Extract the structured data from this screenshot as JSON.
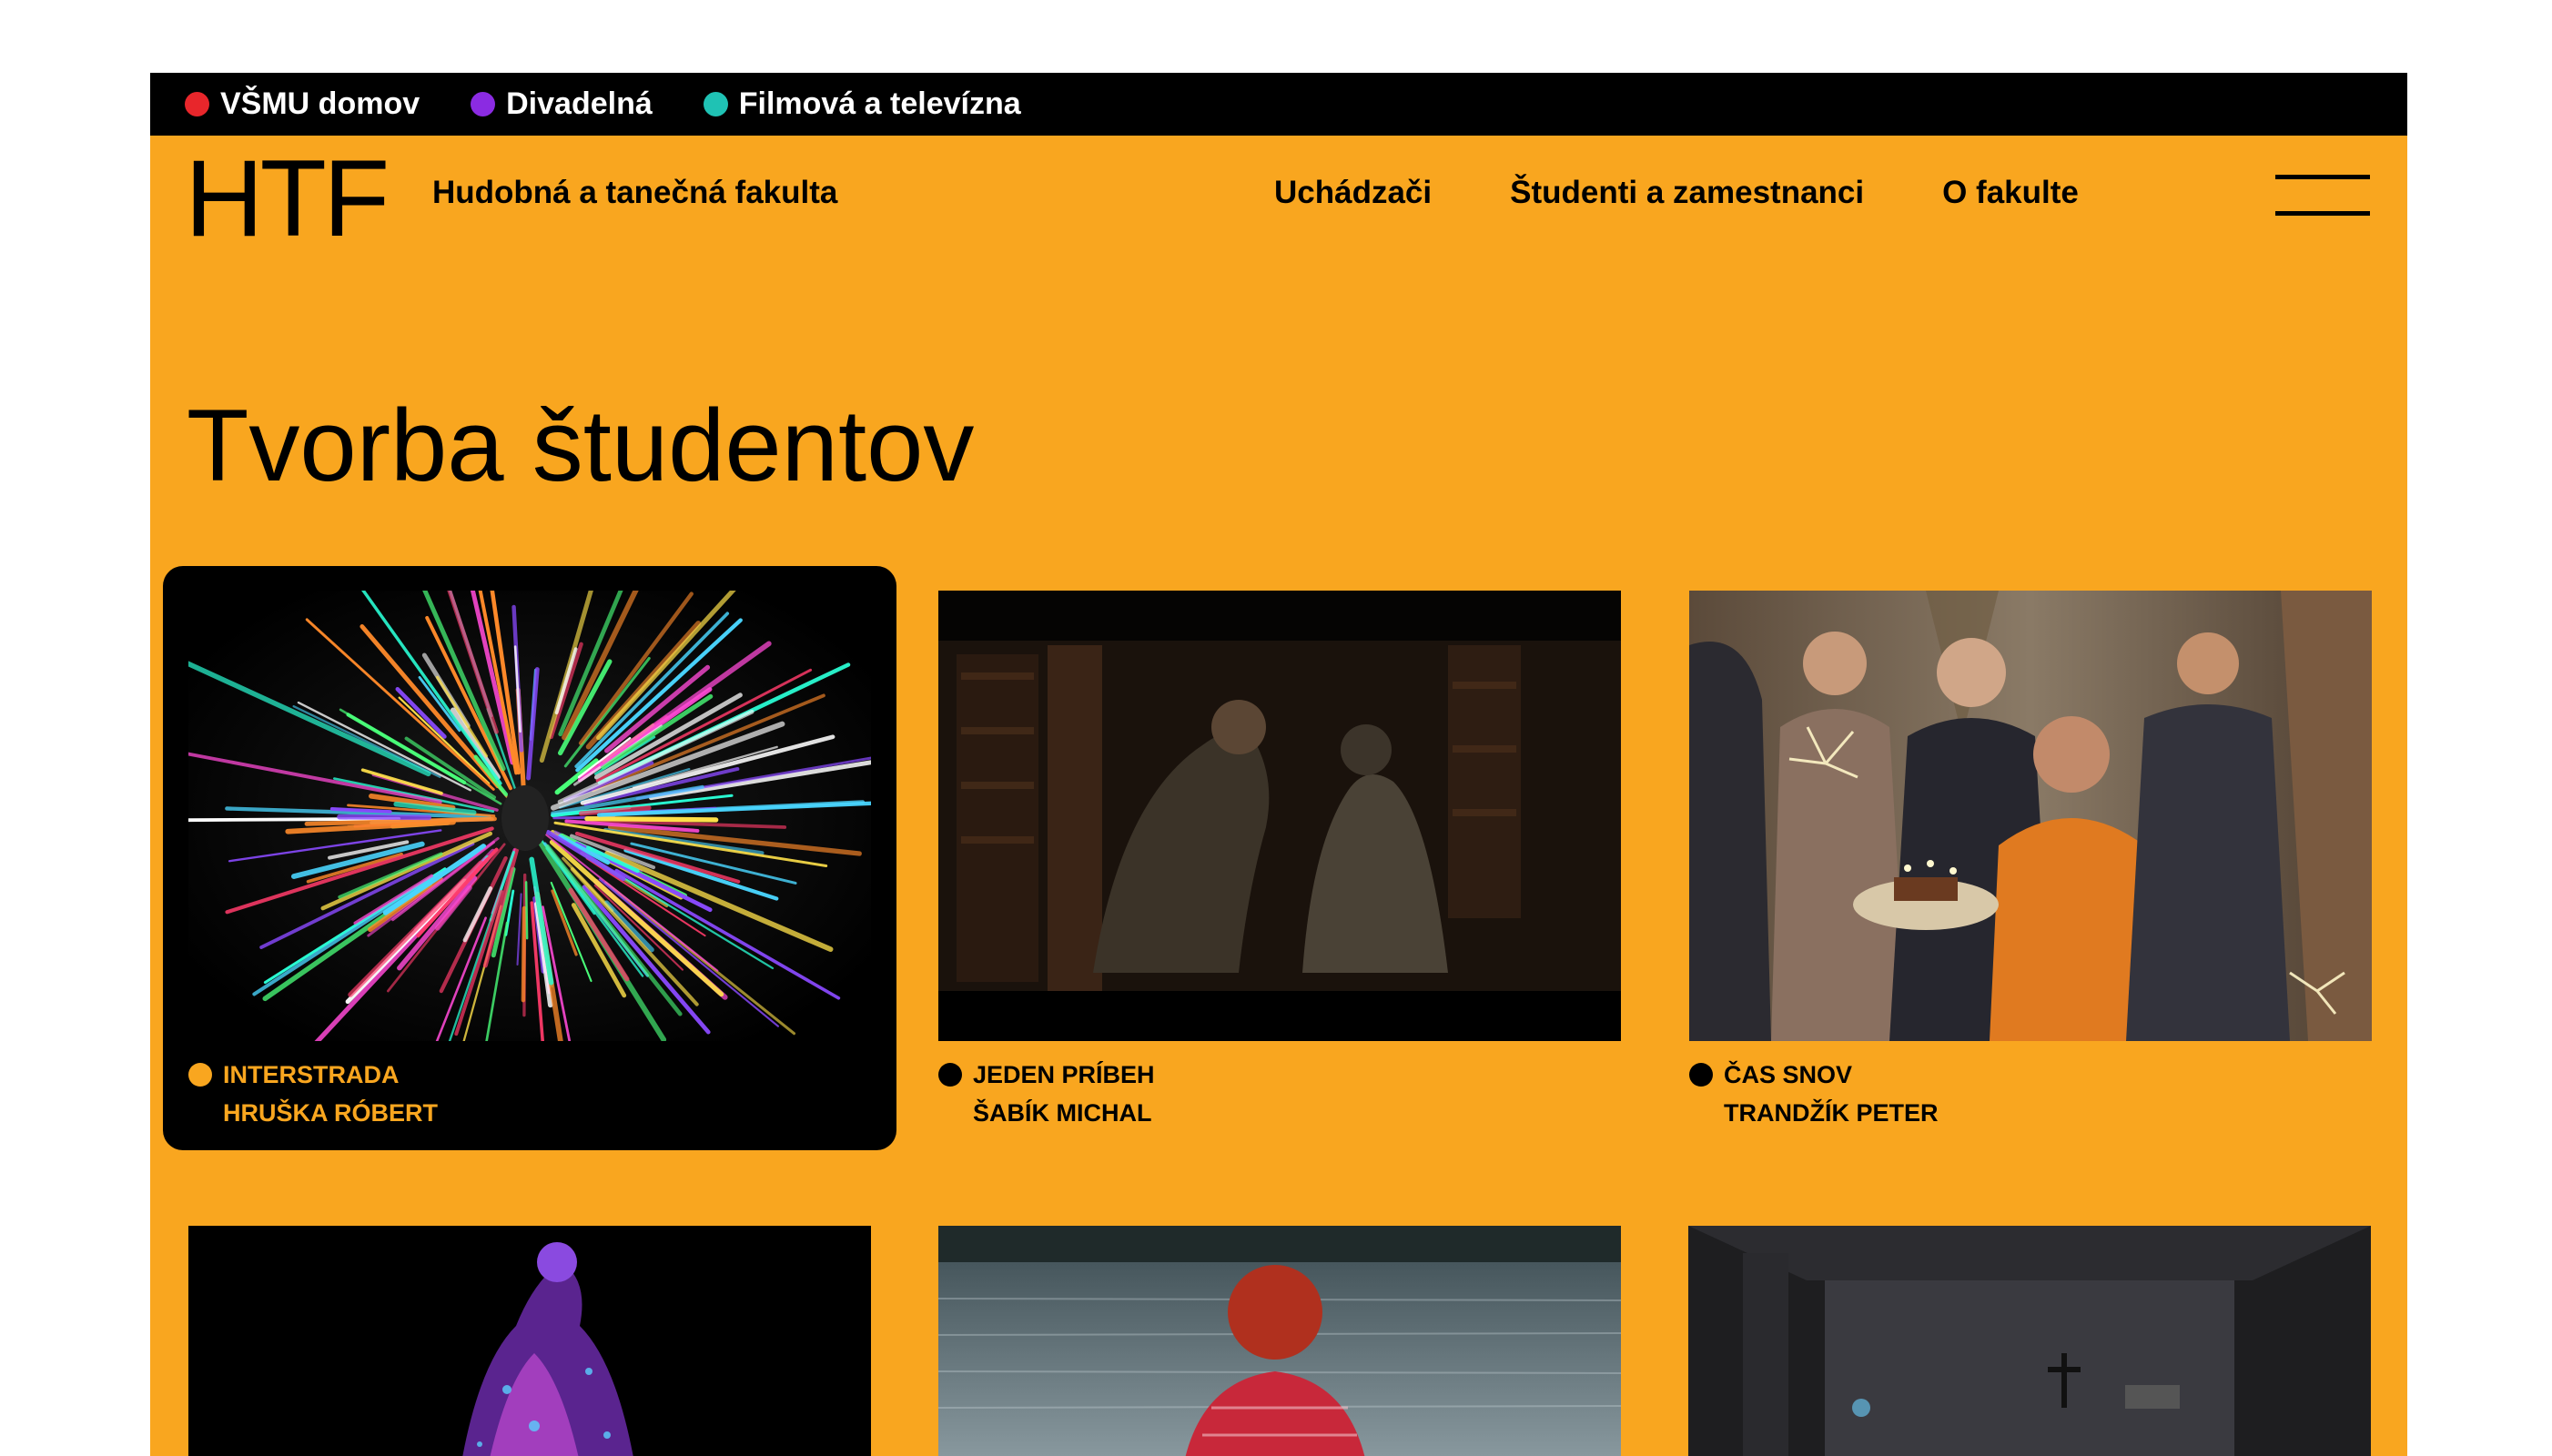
{
  "topbar": {
    "items": [
      {
        "label": "VŠMU domov",
        "color": "#E8262B"
      },
      {
        "label": "Divadelná",
        "color": "#8B2BE2"
      },
      {
        "label": "Filmová a televízna",
        "color": "#1FC2B4"
      }
    ]
  },
  "header": {
    "logo": "HTF",
    "faculty_name": "Hudobná a tanečná fakulta",
    "nav": [
      "Uchádzači",
      "Študenti a zamestnanci",
      "O fakulte"
    ],
    "menu_icon": "hamburger-icon"
  },
  "page": {
    "title": "Tvorba študentov"
  },
  "colors": {
    "brand": "#F9A61F",
    "dark": "#000000"
  },
  "cards": [
    {
      "title": "INTERSTRADA",
      "author": "HRUŠKA RÓBERT",
      "active": true
    },
    {
      "title": "JEDEN PRÍBEH",
      "author": "ŠABÍK MICHAL",
      "active": false
    },
    {
      "title": "ČAS SNOV",
      "author": "TRANDŽÍK PETER",
      "active": false
    }
  ]
}
